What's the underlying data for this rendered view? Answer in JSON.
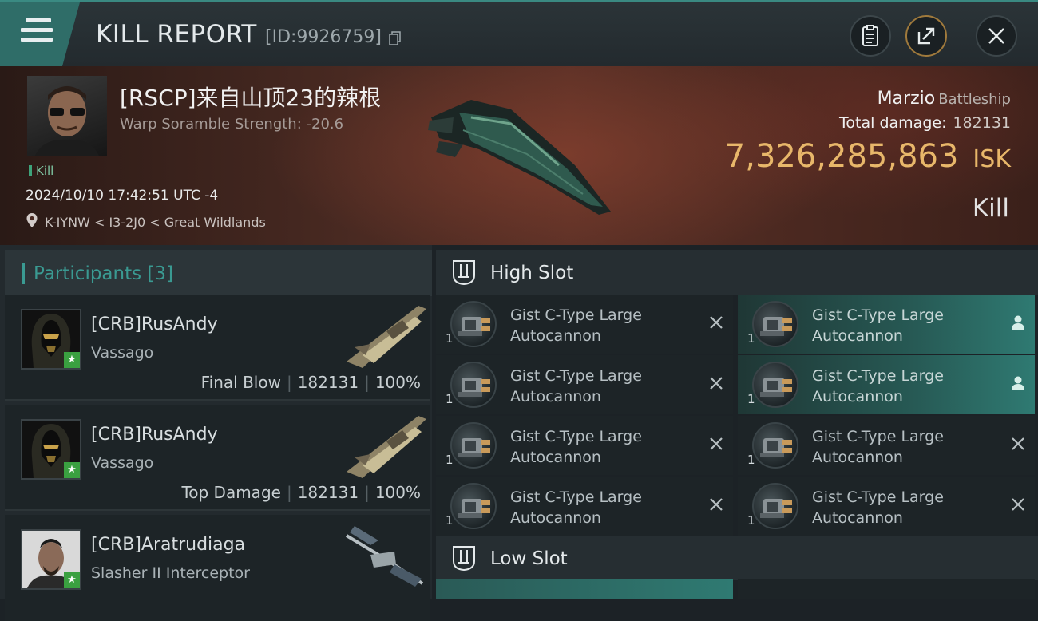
{
  "header": {
    "title": "KILL REPORT",
    "id_text": "[ID:9926759]",
    "buttons": [
      "clipboard-icon",
      "share-icon",
      "close-icon"
    ]
  },
  "victim": {
    "name": "[RSCP]来自山顶23的辣根",
    "subtitle": "Warp Soramble Strength: -20.6",
    "tag": "Kill",
    "datetime": "2024/10/10 17:42:51 UTC -4",
    "location": "K-IYNW < I3-2J0 < Great Wildlands",
    "ship_name": "Marzio",
    "ship_class": "Battleship",
    "total_damage_label": "Total damage:",
    "total_damage": "182131",
    "isk_value": "7,326,285,863",
    "isk_unit": "ISK",
    "result": "Kill"
  },
  "participants": {
    "header": "Participants [3]",
    "items": [
      {
        "name": "[CRB]RusAndy",
        "ship": "Vassago",
        "role": "Final Blow",
        "damage": "182131",
        "percent": "100%"
      },
      {
        "name": "[CRB]RusAndy",
        "ship": "Vassago",
        "role": "Top Damage",
        "damage": "182131",
        "percent": "100%"
      },
      {
        "name": "[CRB]Aratrudiaga",
        "ship": "Slasher II Interceptor",
        "role": "",
        "damage": "",
        "percent": ""
      }
    ]
  },
  "high_slot": {
    "label": "High Slot",
    "modules": [
      {
        "name_line1": "Gist C-Type Large",
        "name_line2": "Autocannon",
        "qty": "1",
        "state": "destroyed",
        "icon": "close-icon"
      },
      {
        "name_line1": "Gist C-Type Large",
        "name_line2": "Autocannon",
        "qty": "1",
        "state": "dropped",
        "icon": "person-icon"
      },
      {
        "name_line1": "Gist C-Type Large",
        "name_line2": "Autocannon",
        "qty": "1",
        "state": "destroyed",
        "icon": "close-icon"
      },
      {
        "name_line1": "Gist C-Type Large",
        "name_line2": "Autocannon",
        "qty": "1",
        "state": "dropped",
        "icon": "person-icon"
      },
      {
        "name_line1": "Gist C-Type Large",
        "name_line2": "Autocannon",
        "qty": "1",
        "state": "destroyed",
        "icon": "close-icon"
      },
      {
        "name_line1": "Gist C-Type Large",
        "name_line2": "Autocannon",
        "qty": "1",
        "state": "destroyed",
        "icon": "close-icon"
      },
      {
        "name_line1": "Gist C-Type Large",
        "name_line2": "Autocannon",
        "qty": "1",
        "state": "destroyed",
        "icon": "close-icon"
      },
      {
        "name_line1": "Gist C-Type Large",
        "name_line2": "Autocannon",
        "qty": "1",
        "state": "destroyed",
        "icon": "close-icon"
      }
    ]
  },
  "low_slot": {
    "label": "Low Slot"
  },
  "colors": {
    "accent_teal": "#3a9a92",
    "isk_gold": "#e8b76a",
    "kill_green": "#3ea37a",
    "star_green": "#3aa040"
  }
}
